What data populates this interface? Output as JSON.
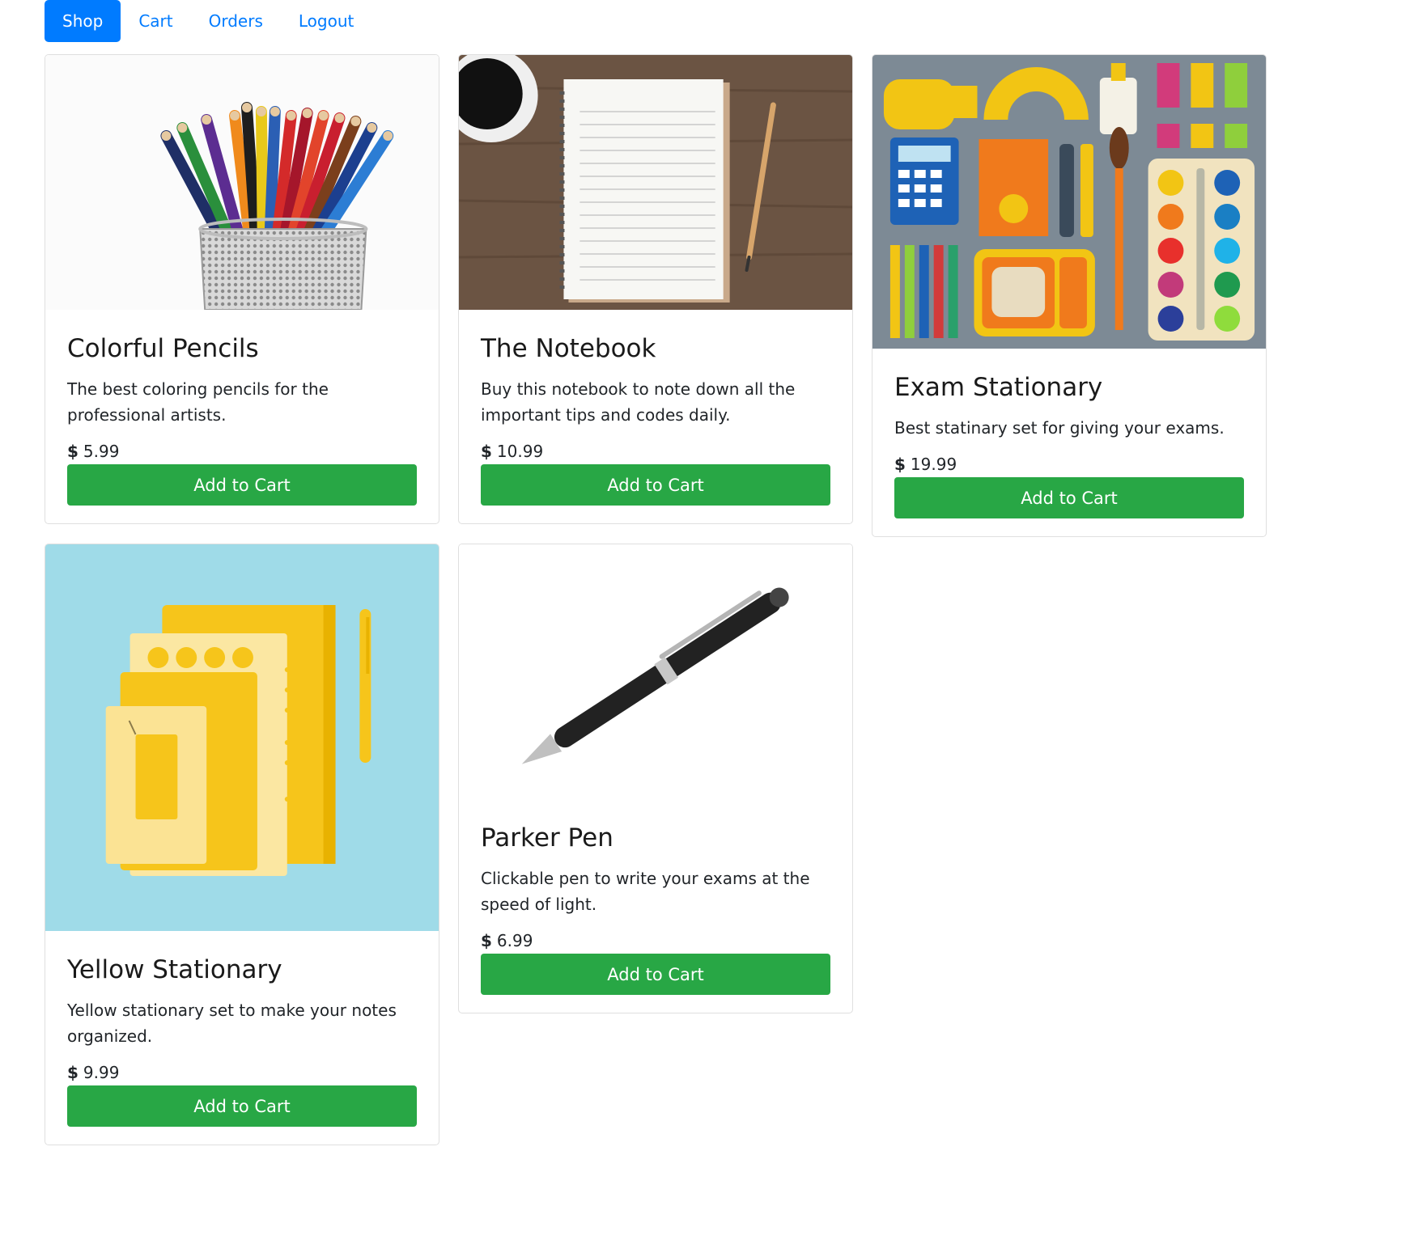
{
  "nav": {
    "items": [
      {
        "label": "Shop",
        "active": true
      },
      {
        "label": "Cart",
        "active": false
      },
      {
        "label": "Orders",
        "active": false
      },
      {
        "label": "Logout",
        "active": false
      }
    ]
  },
  "products": [
    {
      "title": "Colorful Pencils",
      "description": "The best coloring pencils for the professional artists.",
      "currency": "$",
      "price": "5.99",
      "button_label": "Add to Cart",
      "image": "pencils-in-mesh-cup-image"
    },
    {
      "title": "The Notebook",
      "description": "Buy this notebook to note down all the important tips and codes daily.",
      "currency": "$",
      "price": "10.99",
      "button_label": "Add to Cart",
      "image": "notebook-coffee-pencil-image"
    },
    {
      "title": "Exam Stationary",
      "description": "Best statinary set for giving your exams.",
      "currency": "$",
      "price": "19.99",
      "button_label": "Add to Cart",
      "image": "flat-stationery-set-image"
    },
    {
      "title": "Yellow Stationary",
      "description": "Yellow stationary set to make your notes organized.",
      "currency": "$",
      "price": "9.99",
      "button_label": "Add to Cart",
      "image": "yellow-notebooks-image"
    },
    {
      "title": "Parker Pen",
      "description": "Clickable pen to write your exams at the speed of light.",
      "currency": "$",
      "price": "6.99",
      "button_label": "Add to Cart",
      "image": "black-pen-image"
    }
  ],
  "colors": {
    "primary": "#007bff",
    "success": "#28a745",
    "border": "#dfdfdf"
  }
}
